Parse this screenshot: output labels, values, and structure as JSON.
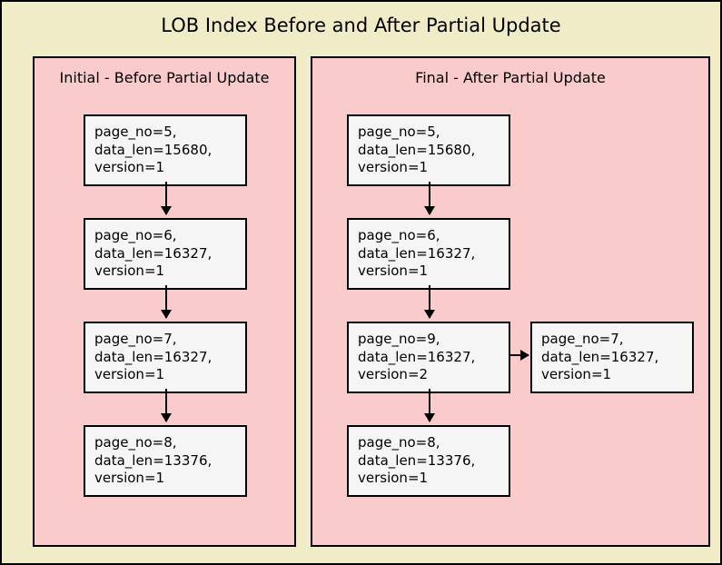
{
  "title": "LOB Index Before and After Partial Update",
  "left": {
    "title": "Initial - Before Partial Update",
    "nodes": [
      {
        "page_no": 5,
        "data_len": 15680,
        "version": 1
      },
      {
        "page_no": 6,
        "data_len": 16327,
        "version": 1
      },
      {
        "page_no": 7,
        "data_len": 16327,
        "version": 1
      },
      {
        "page_no": 8,
        "data_len": 13376,
        "version": 1
      }
    ]
  },
  "right": {
    "title": "Final - After Partial Update",
    "nodes": [
      {
        "page_no": 5,
        "data_len": 15680,
        "version": 1
      },
      {
        "page_no": 6,
        "data_len": 16327,
        "version": 1
      },
      {
        "page_no": 9,
        "data_len": 16327,
        "version": 2
      },
      {
        "page_no": 8,
        "data_len": 13376,
        "version": 1
      }
    ],
    "side_node": {
      "page_no": 7,
      "data_len": 16327,
      "version": 1
    }
  }
}
